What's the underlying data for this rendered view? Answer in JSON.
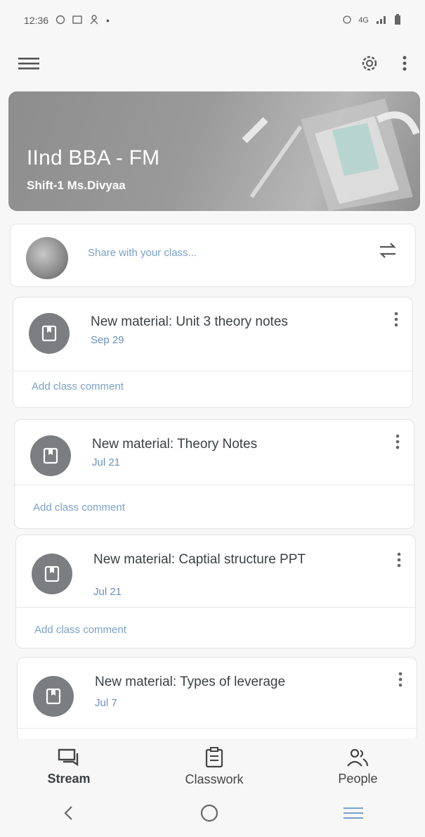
{
  "status": {
    "time": "12:36",
    "network": "4G"
  },
  "banner": {
    "title": "IInd BBA - FM",
    "subtitle": "Shift-1 Ms.Divyaa"
  },
  "share": {
    "placeholder": "Share with your class..."
  },
  "posts": [
    {
      "title": "New material: Unit 3 theory notes",
      "date": "Sep 29",
      "comment": "Add class comment"
    },
    {
      "title": "New material: Theory Notes",
      "date": "Jul 21",
      "comment": "Add class comment"
    },
    {
      "title": "New material: Captial structure PPT",
      "date": "Jul 21",
      "comment": "Add class comment"
    },
    {
      "title": "New material: Types of leverage",
      "date": "Jul 7"
    }
  ],
  "nav": {
    "stream": "Stream",
    "classwork": "Classwork",
    "people": "People"
  },
  "colors": {
    "accent_blue": "#6a8fbd",
    "icon_grey": "#7b7d80"
  }
}
